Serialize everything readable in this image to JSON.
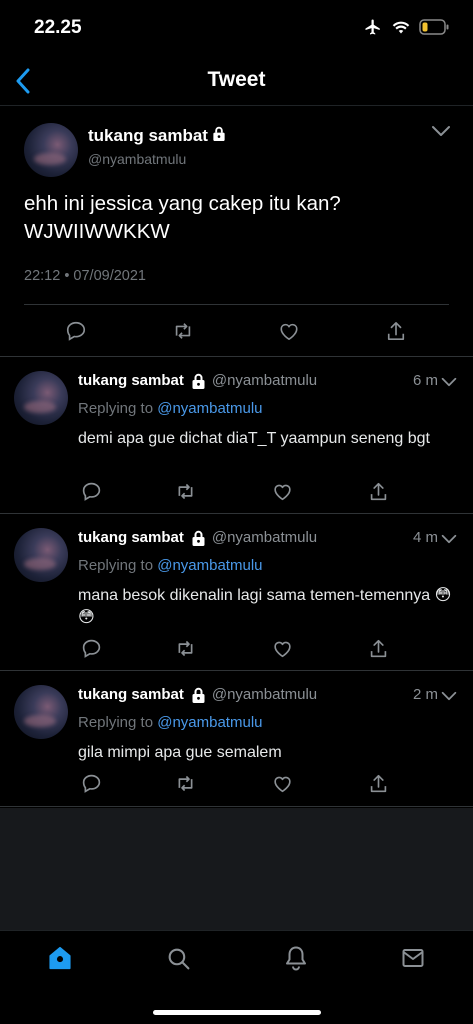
{
  "status": {
    "time": "22.25"
  },
  "nav": {
    "title": "Tweet"
  },
  "main_tweet": {
    "name": "tukang sambat",
    "handle": "@nyambatmulu",
    "text": "ehh ini jessica yang cakep itu kan? WJWIIWWKKW",
    "timestamp": "22:12 • 07/09/2021"
  },
  "replies": [
    {
      "name": "tukang sambat",
      "handle": "@nyambatmulu",
      "time": "6 m",
      "replying_prefix": "Replying to",
      "replying_to": "@nyambatmulu",
      "text": "demi apa gue dichat diaT_T yaampun seneng bgt"
    },
    {
      "name": "tukang sambat",
      "handle": "@nyambatmulu",
      "time": "4 m",
      "replying_prefix": "Replying to",
      "replying_to": "@nyambatmulu",
      "text": "mana besok dikenalin lagi sama temen-temennya 😳😳"
    },
    {
      "name": "tukang sambat",
      "handle": "@nyambatmulu",
      "time": "2 m",
      "replying_prefix": "Replying to",
      "replying_to": "@nyambatmulu",
      "text": "gila mimpi apa gue semalem"
    }
  ],
  "tabs": [
    "home-icon",
    "search-icon",
    "bell-icon",
    "mail-icon"
  ],
  "colors": {
    "accent": "#1d9bf0",
    "mention": "#4a99e9",
    "muted": "#71767b",
    "battery": "#f2c230"
  }
}
